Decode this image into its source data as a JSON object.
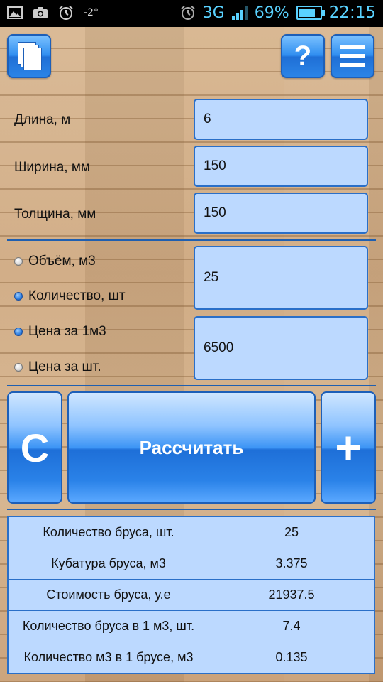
{
  "status_bar": {
    "temperature": "-2°",
    "network": "3G",
    "battery_percent": "69%",
    "battery_level": 0.69,
    "time": "22:15",
    "icons": [
      "image-icon",
      "camera-icon",
      "alarm-icon",
      "alarm-icon",
      "signal-icon",
      "battery-icon"
    ]
  },
  "toolbar": {
    "help_label": "?",
    "icons": [
      "pages-icon",
      "help-icon",
      "menu-icon"
    ]
  },
  "inputs": {
    "length_label": "Длина, м",
    "length_value": "6",
    "width_label": "Ширина, мм",
    "width_value": "150",
    "thickness_label": "Толщина, мм",
    "thickness_value": "150"
  },
  "mode": {
    "volume_label": "Объём, м3",
    "quantity_label": "Количество, шт",
    "quantity_selected": true,
    "amount_value": "25",
    "price_m3_label": "Цена за 1м3",
    "price_m3_selected": true,
    "price_piece_label": "Цена за шт.",
    "price_value": "6500"
  },
  "actions": {
    "clear_label": "C",
    "calculate_label": "Рассчитать",
    "add_label": "+"
  },
  "results": [
    {
      "label": "Количество бруса, шт.",
      "value": "25"
    },
    {
      "label": "Кубатура бруса, м3",
      "value": "3.375"
    },
    {
      "label": "Стоимость бруса, у.е",
      "value": "21937.5"
    },
    {
      "label": "Количество бруса в 1 м3, шт.",
      "value": "7.4"
    },
    {
      "label": "Количество м3 в 1 брусе, м3",
      "value": "0.135"
    }
  ],
  "colors": {
    "accent": "#2f8ef0",
    "field_bg": "#bcd9ff",
    "status_text": "#5ad2ff"
  }
}
